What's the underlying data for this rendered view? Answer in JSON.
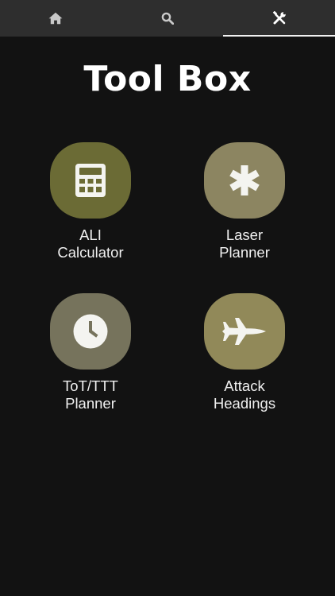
{
  "tabs": [
    {
      "icon": "home-icon"
    },
    {
      "icon": "search-icon"
    },
    {
      "icon": "tools-icon",
      "active": true
    }
  ],
  "page": {
    "title": "Tool Box"
  },
  "tools": [
    {
      "icon": "calculator-icon",
      "line1": "ALI",
      "line2": "Calculator",
      "color": "#6b6b35"
    },
    {
      "icon": "asterisk-icon",
      "line1": "Laser",
      "line2": "Planner",
      "color": "#8c8561"
    },
    {
      "icon": "clock-icon",
      "line1": "ToT/TTT",
      "line2": "Planner",
      "color": "#76735c"
    },
    {
      "icon": "jet-icon",
      "line1": "Attack",
      "line2": "Headings",
      "color": "#918959"
    }
  ],
  "colors": {
    "background": "#121212",
    "tabbar": "#2e2e2e",
    "tab_icon": "#c9c9c9",
    "active_tab_icon": "#ffffff"
  }
}
